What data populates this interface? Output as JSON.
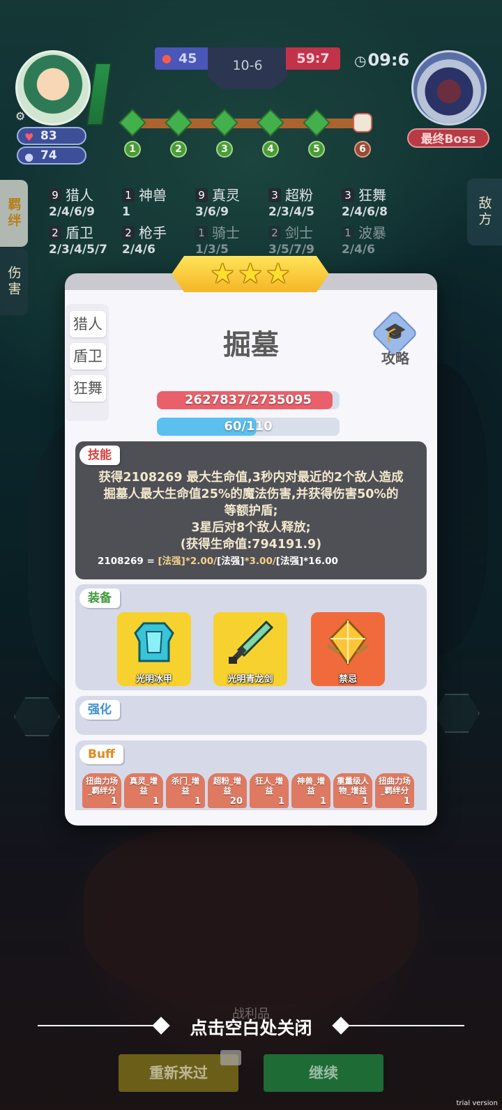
{
  "hud": {
    "player_hp": "83",
    "player_gold": "74",
    "left_score": "45",
    "round": "10-6",
    "right_score": "59:7",
    "timer": "09:6",
    "boss_label": "最终Boss",
    "stages": [
      "1",
      "2",
      "3",
      "4",
      "5",
      "6"
    ]
  },
  "side_tabs": {
    "bond": "羁绊",
    "damage": "伤害",
    "enemy": "敌方"
  },
  "synergies": [
    {
      "count": "9",
      "name": "猎人",
      "tiers": "2/4/6/9"
    },
    {
      "count": "1",
      "name": "神兽",
      "tiers": "1"
    },
    {
      "count": "9",
      "name": "真灵",
      "tiers": "3/6/9"
    },
    {
      "count": "3",
      "name": "超粉",
      "tiers": "2/3/4/5"
    },
    {
      "count": "3",
      "name": "狂舞",
      "tiers": "2/4/6/8"
    },
    {
      "count": "2",
      "name": "盾卫",
      "tiers": "2/3/4/5/7"
    },
    {
      "count": "2",
      "name": "枪手",
      "tiers": "2/4/6"
    },
    {
      "count": "1",
      "name": "骑士",
      "tiers": "1/3/5"
    },
    {
      "count": "2",
      "name": "剑士",
      "tiers": "3/5/7/9"
    },
    {
      "count": "1",
      "name": "波暴",
      "tiers": "2/4/6"
    }
  ],
  "modal": {
    "stars": 3,
    "class_tabs": [
      "猎人",
      "盾卫",
      "狂舞"
    ],
    "unit_name": "掘墓",
    "guide_label": "攻略",
    "hp_text": "2627837/2735095",
    "hp_fraction": 0.96,
    "mp_text": "60/110",
    "mp_fraction": 0.545,
    "skill": {
      "label": "技能",
      "lines": [
        "获得2108269 最大生命值,3秒内对最近的2个敌人造成",
        "掘墓人最大生命值25%的魔法伤害,并获得伤害50%的",
        "等额护盾;",
        "3星后对8个敌人释放;",
        "(获得生命值:794191.9)"
      ],
      "formula_value": "2108269 = ",
      "formula_p1": "[法强]",
      "formula_m1": "*2.00/",
      "formula_p2": "[法强]",
      "formula_m2": "*3.00/",
      "formula_p3": "[法强]",
      "formula_m3": "*16.00"
    },
    "equipment": {
      "label": "装备",
      "items": [
        {
          "name": "光明冰甲",
          "icon": "armor-icon"
        },
        {
          "name": "光明青龙剑",
          "icon": "sword-icon"
        },
        {
          "name": "禁忌",
          "icon": "crystal-icon"
        }
      ]
    },
    "enhance": {
      "label": "强化"
    },
    "buff": {
      "label": "Buff",
      "items": [
        {
          "line1": "扭曲力场",
          "line2": "_羁绊分",
          "count": "1"
        },
        {
          "line1": "真灵_增",
          "line2": "益",
          "count": "1"
        },
        {
          "line1": "杀门_增",
          "line2": "益",
          "count": "1"
        },
        {
          "line1": "超粉_增",
          "line2": "益",
          "count": "20"
        },
        {
          "line1": "狂人_增",
          "line2": "益",
          "count": "1"
        },
        {
          "line1": "神兽_增",
          "line2": "益",
          "count": "1"
        },
        {
          "line1": "重量级人",
          "line2": "物_增益",
          "count": "1"
        },
        {
          "line1": "扭曲力场",
          "line2": "_羁绊分",
          "count": "1"
        }
      ]
    }
  },
  "bottom": {
    "close_hint": "点击空白处关闭",
    "loot_ghost": "战利品",
    "retry": "重新来过",
    "continue": "继续",
    "watermark": "trial version"
  }
}
